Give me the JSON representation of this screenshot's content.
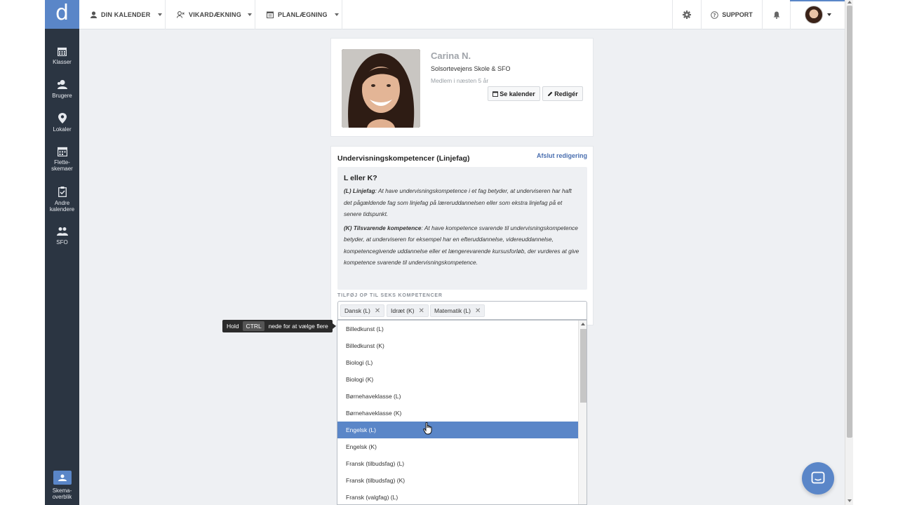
{
  "app": {
    "logo_letter": "d",
    "accent_color": "#5a86c8",
    "sidebar_color": "#2b3542"
  },
  "sidebar": {
    "items": [
      {
        "label": "Klasser",
        "icon": "calendar-grid-icon"
      },
      {
        "label": "Brugere",
        "icon": "users-icon"
      },
      {
        "label": "Lokaler",
        "icon": "map-pin-icon"
      },
      {
        "label": "Flette-skemaer",
        "icon": "calendar-icon"
      },
      {
        "label": "Andre kalendere",
        "icon": "clipboard-check-icon"
      },
      {
        "label": "SFO",
        "icon": "group-icon"
      }
    ],
    "bottom": {
      "label": "Skema-overblik",
      "icon": "schedule-overview-icon"
    }
  },
  "topnav": {
    "items": [
      {
        "label": "DIN KALENDER",
        "icon": "user-icon"
      },
      {
        "label": "VIKARDÆKNING",
        "icon": "substitute-icon"
      },
      {
        "label": "PLANLÆGNING",
        "icon": "calendar-icon"
      }
    ],
    "support_label": "SUPPORT"
  },
  "profile": {
    "name": "Carina N.",
    "school": "Solsortevejens Skole & SFO",
    "member_since": "Medlem i næsten 5 år",
    "calendar_button": "Se kalender",
    "edit_button": "Redigér"
  },
  "competences": {
    "title": "Undervisningskompetencer (Linjefag)",
    "end_edit_link": "Afslut redigering",
    "info_heading": "L eller K?",
    "info_l_bold": "(L) Linjefag",
    "info_l_text": ": At have undervisningskompetence i et fag betyder, at underviseren har haft det pågældende fag som linjefag på læreruddannelsen eller som ekstra linjefag på et senere tidspunkt.",
    "info_k_bold": "(K) Tilsvarende kompetence",
    "info_k_text": ": At have kompetence svarende til undervisningskompetence betyder, at underviseren for eksempel har en efteruddannelse, videreuddannelse, kompetencegivende uddannelse eller et længerevarende kursusforløb, der vurderes at give kompetence svarende til undervisningskompetence.",
    "add_label": "TILFØJ OP TIL SEKS KOMPETENCER",
    "selected_tags": [
      "Dansk (L)",
      "Idræt (K)",
      "Matematik (L)"
    ]
  },
  "dropdown": {
    "options": [
      "Billedkunst (L)",
      "Billedkunst (K)",
      "Biologi (L)",
      "Biologi (K)",
      "Børnehaveklasse (L)",
      "Børnehaveklasse (K)",
      "Engelsk (L)",
      "Engelsk (K)",
      "Fransk (tilbudsfag) (L)",
      "Fransk (tilbudsfag) (K)",
      "Fransk (valgfag) (L)"
    ],
    "highlighted": "Engelsk (L)"
  },
  "tooltip": {
    "prefix": "Hold",
    "key": "CTRL",
    "suffix": "nede for at vælge flere"
  }
}
